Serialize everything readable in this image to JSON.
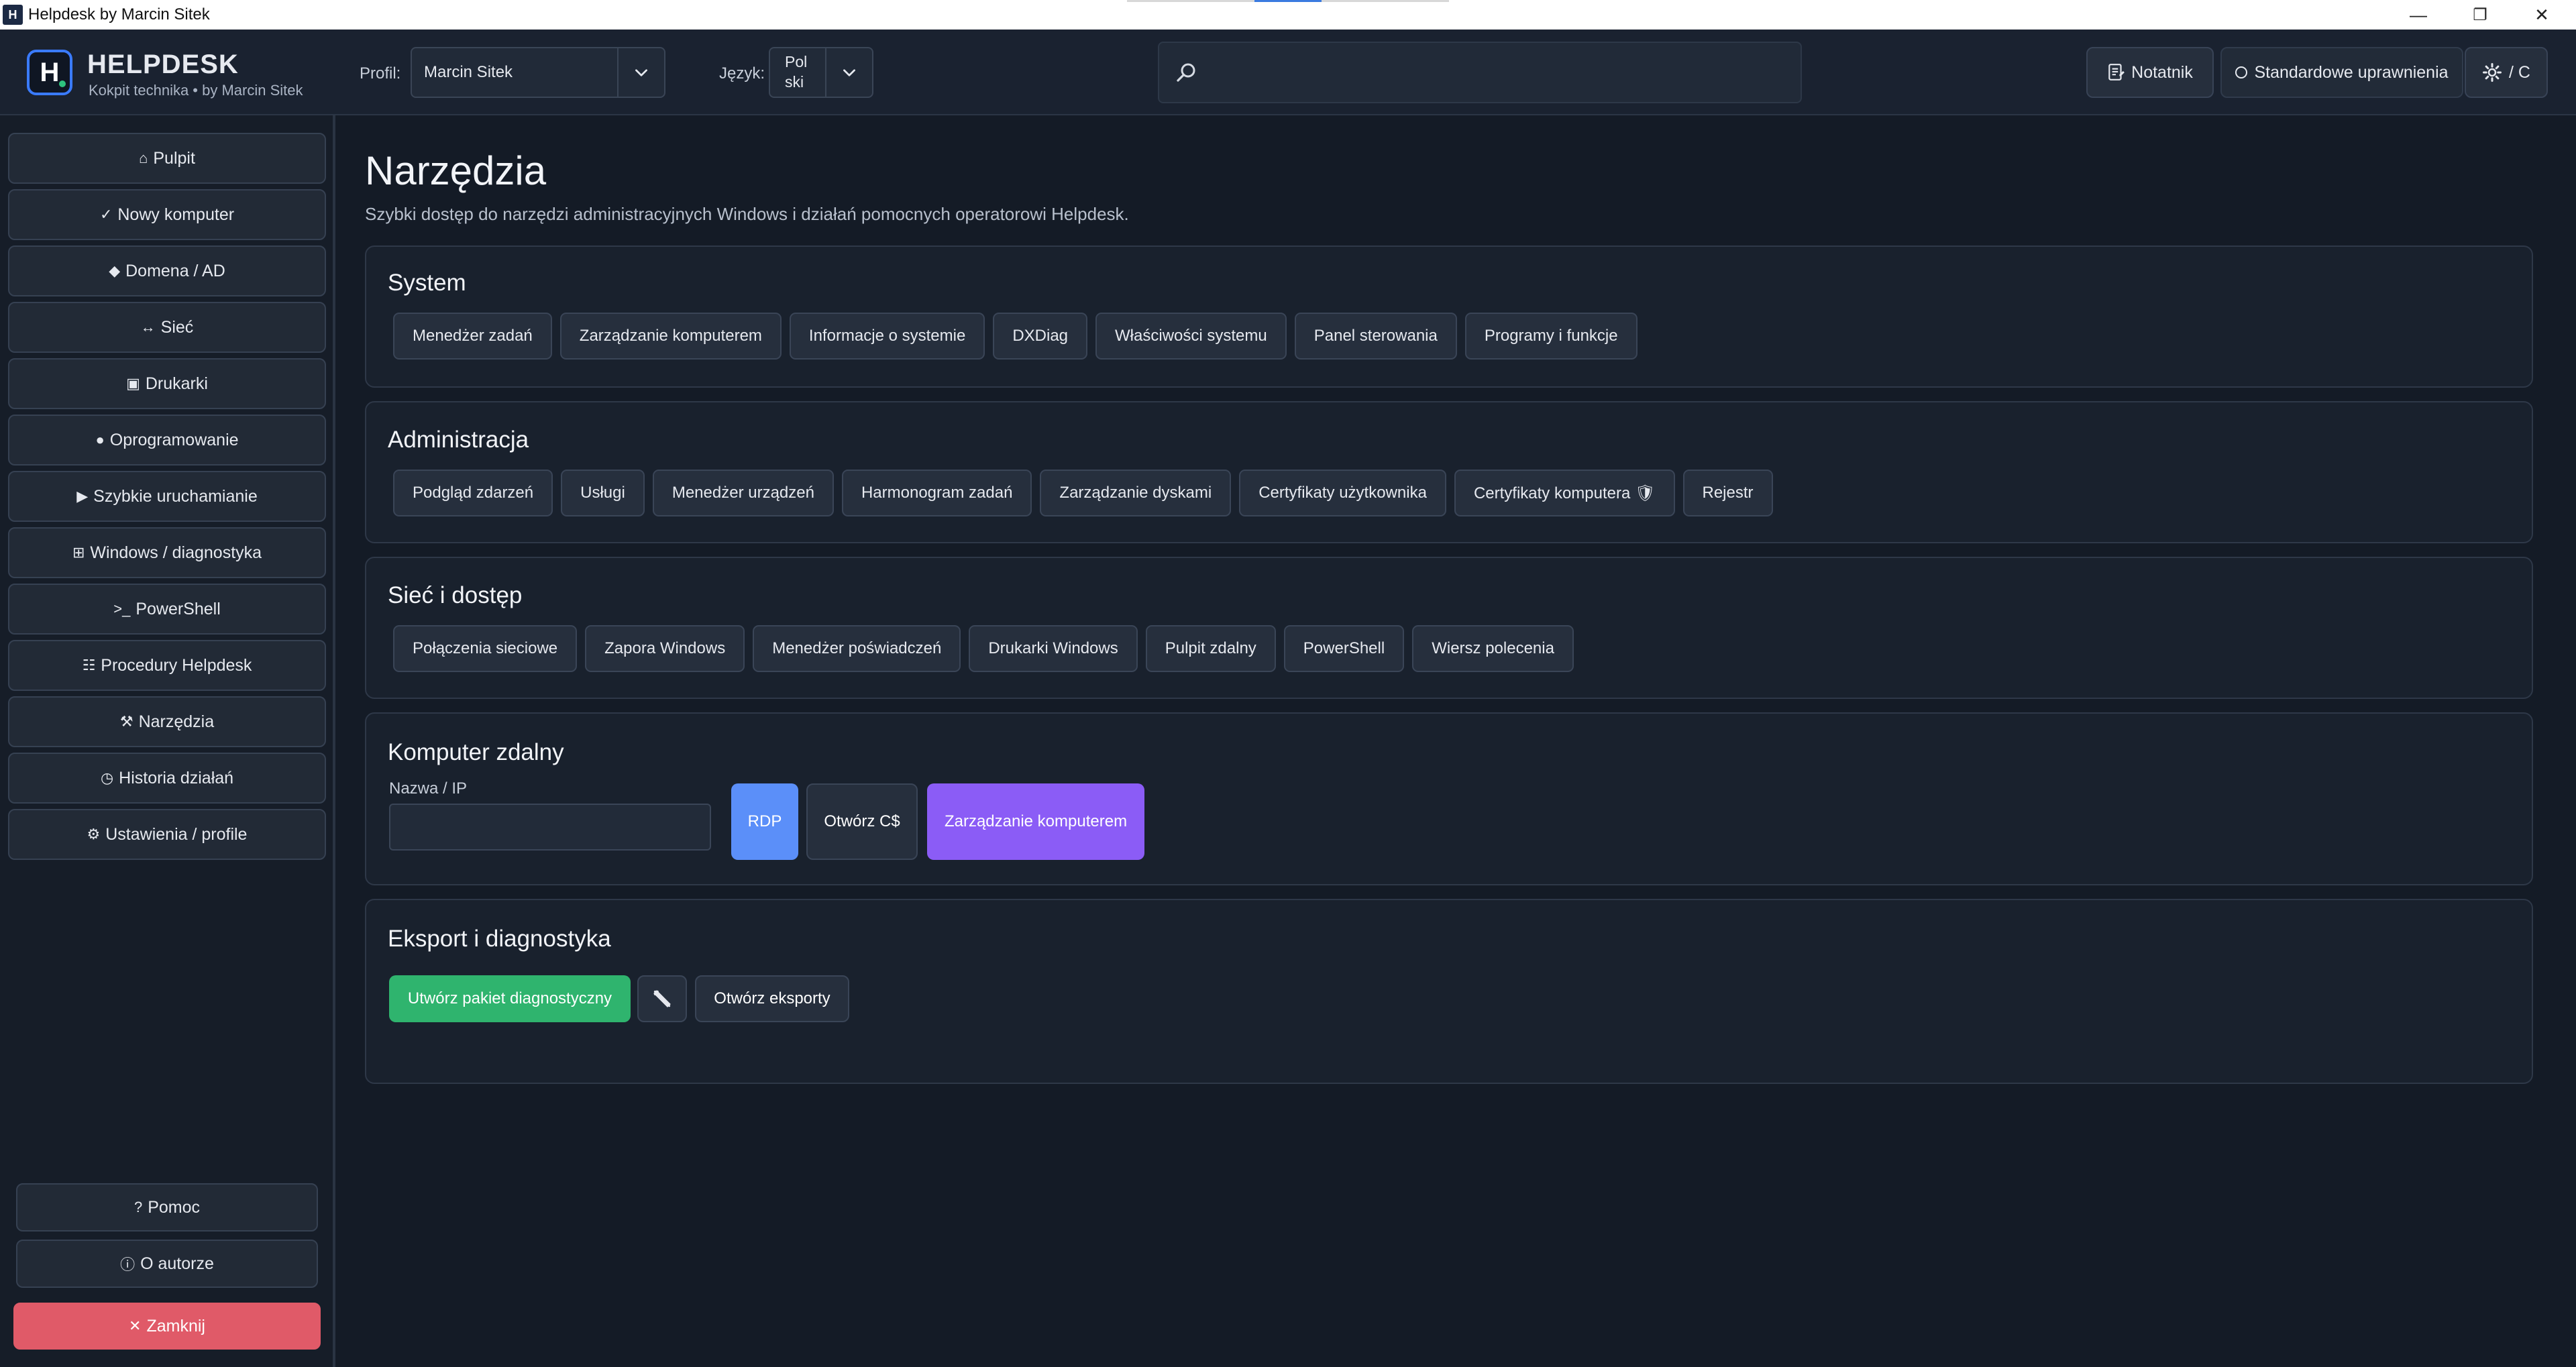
{
  "window": {
    "title": "Helpdesk by Marcin Sitek",
    "icon_text": "H"
  },
  "header": {
    "brand": "HELPDESK",
    "subtitle": "Kokpit technika • by Marcin Sitek",
    "profile_label": "Profil:",
    "profile_value": "Marcin Sitek",
    "language_label": "Język:",
    "language_value_line1": "Pol",
    "language_value_line2": "ski",
    "search_placeholder": "",
    "notepad_label": "Notatnik",
    "permissions_label": "Standardowe uprawnienia",
    "theme_label": "/ C"
  },
  "sidebar": {
    "items": [
      {
        "glyph": "⌂",
        "label": "Pulpit"
      },
      {
        "glyph": "✓",
        "label": "Nowy komputer"
      },
      {
        "glyph": "◆",
        "label": "Domena / AD"
      },
      {
        "glyph": "↔",
        "label": "Sieć"
      },
      {
        "glyph": "▣",
        "label": "Drukarki"
      },
      {
        "glyph": "●",
        "label": "Oprogramowanie"
      },
      {
        "glyph": "▶",
        "label": "Szybkie uruchamianie"
      },
      {
        "glyph": "⊞",
        "label": "Windows / diagnostyka"
      },
      {
        "glyph": ">_",
        "label": "PowerShell"
      },
      {
        "glyph": "☷",
        "label": "Procedury Helpdesk"
      },
      {
        "glyph": "⚒",
        "label": "Narzędzia"
      },
      {
        "glyph": "◷",
        "label": "Historia działań"
      },
      {
        "glyph": "⚙",
        "label": "Ustawienia / profile"
      }
    ],
    "help": {
      "glyph": "?",
      "label": "Pomoc"
    },
    "about": {
      "glyph": "ⓘ",
      "label": "O autorze"
    },
    "close": {
      "glyph": "✕",
      "label": "Zamknij"
    }
  },
  "main": {
    "title": "Narzędzia",
    "subtitle": "Szybki dostęp do narzędzi administracyjnych Windows i działań pomocnych operatorowi Helpdesk.",
    "sections": [
      {
        "title": "System",
        "buttons": [
          "Menedżer zadań",
          "Zarządzanie komputerem",
          "Informacje o systemie",
          "DXDiag",
          "Właściwości systemu",
          "Panel sterowania",
          "Programy i funkcje"
        ]
      },
      {
        "title": "Administracja",
        "buttons": [
          "Podgląd zdarzeń",
          "Usługi",
          "Menedżer urządzeń",
          "Harmonogram zadań",
          "Zarządzanie dyskami",
          "Certyfikaty użytkownika",
          "Certyfikaty komputera 🛡",
          "Rejestr"
        ]
      },
      {
        "title": "Sieć i dostęp",
        "buttons": [
          "Połączenia sieciowe",
          "Zapora Windows",
          "Menedżer poświadczeń",
          "Drukarki Windows",
          "Pulpit zdalny",
          "PowerShell",
          "Wiersz polecenia"
        ]
      }
    ],
    "remote": {
      "title": "Komputer zdalny",
      "field_label": "Nazwa / IP",
      "field_value": "",
      "rdp_label": "RDP",
      "open_c_label": "Otwórz C$",
      "manage_label": "Zarządzanie komputerem"
    },
    "export": {
      "title": "Eksport i diagnostyka",
      "create_label": "Utwórz pakiet diagnostyczny",
      "open_label": "Otwórz eksporty"
    }
  },
  "colors": {
    "accent_blue": "#5b8ff9",
    "accent_purple": "#8b5cf6",
    "accent_green": "#2fb46e",
    "danger": "#e05a68"
  }
}
